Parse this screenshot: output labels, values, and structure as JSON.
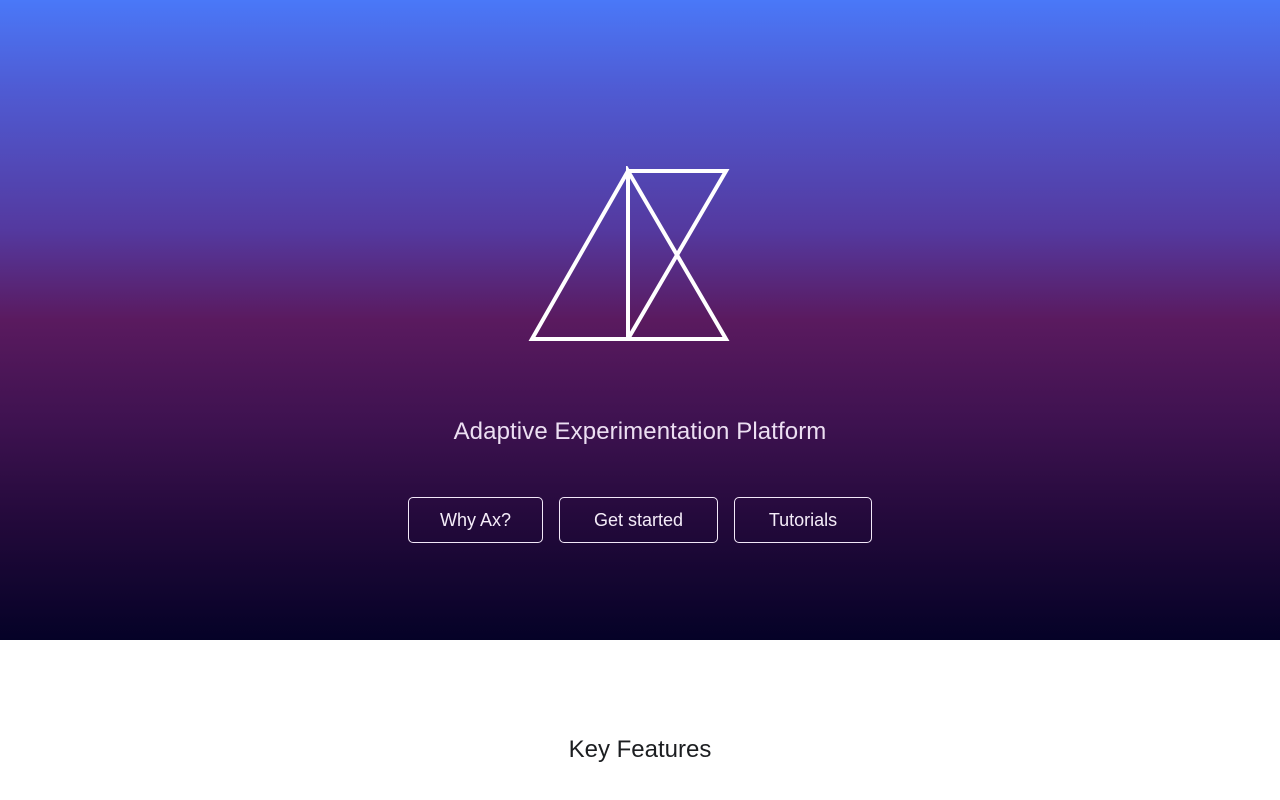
{
  "hero": {
    "logo_icon": "ax-logo-icon",
    "tagline": "Adaptive Experimentation Platform",
    "buttons": {
      "why": "Why Ax?",
      "get_started": "Get started",
      "tutorials": "Tutorials"
    },
    "gradient_colors": [
      "#4a78f8",
      "#5a1a5f",
      "#050227"
    ]
  },
  "features": {
    "title": "Key Features"
  }
}
